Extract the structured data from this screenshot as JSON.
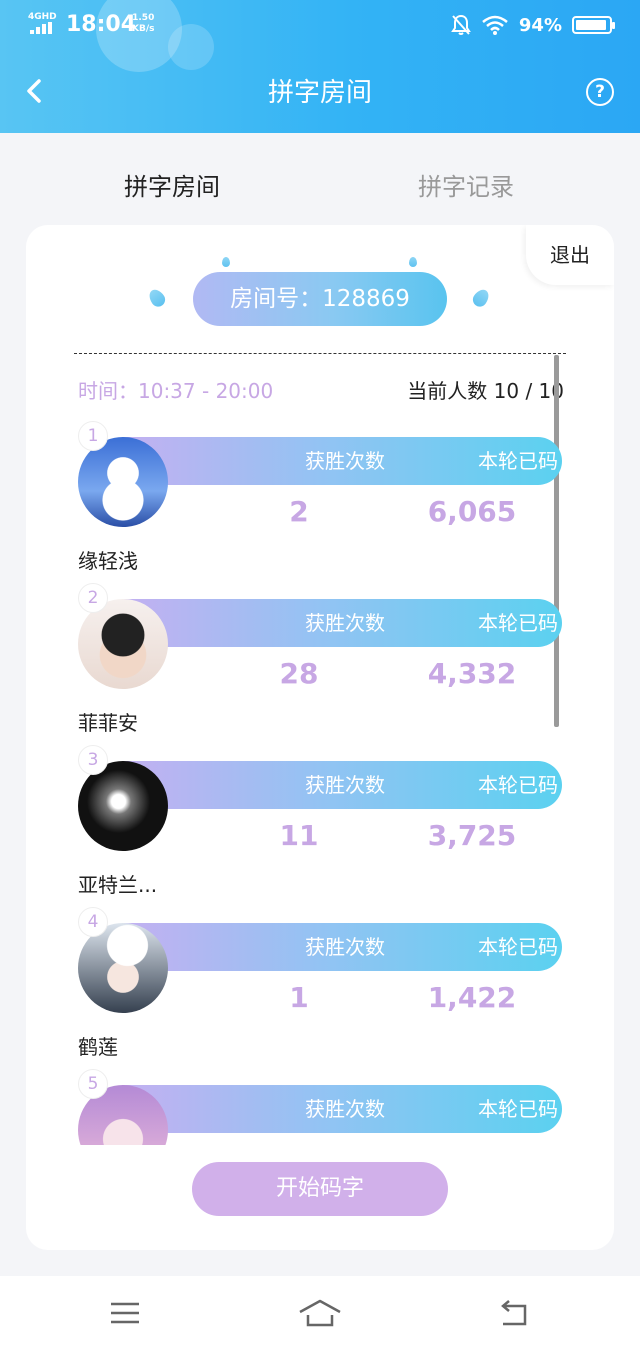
{
  "status_bar": {
    "network": "4GHD",
    "time": "18:04",
    "speed_value": "1.50",
    "speed_unit": "KB/s",
    "battery": "94%"
  },
  "nav": {
    "title": "拼字房间",
    "help_glyph": "?"
  },
  "tabs": [
    {
      "label": "拼字房间",
      "active": true
    },
    {
      "label": "拼字记录",
      "active": false
    }
  ],
  "room": {
    "exit_label": "退出",
    "room_number": "房间号：128869",
    "time": "时间：10:37 - 20:00",
    "member_count": "当前人数 10 / 10"
  },
  "stat_headers": {
    "wins": "获胜次数",
    "coded": "本轮已码"
  },
  "players": [
    {
      "rank": "1",
      "name": "缘轻浅",
      "wins": "2",
      "coded": "6,065"
    },
    {
      "rank": "2",
      "name": "菲菲安",
      "wins": "28",
      "coded": "4,332"
    },
    {
      "rank": "3",
      "name": "亚特兰...",
      "wins": "11",
      "coded": "3,725"
    },
    {
      "rank": "4",
      "name": "鹤莲",
      "wins": "1",
      "coded": "1,422"
    },
    {
      "rank": "5",
      "name": "",
      "wins": "",
      "coded": ""
    }
  ],
  "start_button": "开始码字",
  "colors": {
    "header_blue": "#33b3f5",
    "accent_purple": "#c7a7e4",
    "start_button": "#d1b0ea"
  }
}
